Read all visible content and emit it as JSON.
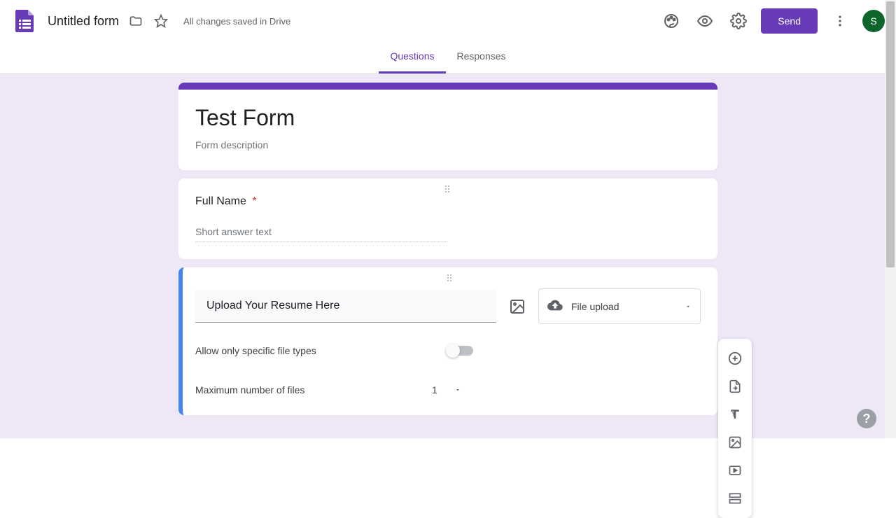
{
  "header": {
    "form_name": "Untitled form",
    "save_status": "All changes saved in Drive",
    "send_label": "Send",
    "avatar_initial": "S"
  },
  "tabs": {
    "questions": "Questions",
    "responses": "Responses"
  },
  "form": {
    "title": "Test Form",
    "description_placeholder": "Form description"
  },
  "q1": {
    "label": "Full Name",
    "required_mark": "*",
    "answer_placeholder": "Short answer text"
  },
  "q2": {
    "question_text": "Upload Your Resume Here",
    "type_label": "File upload",
    "allow_specific_label": "Allow only specific file types",
    "max_files_label": "Maximum number of files",
    "max_files_value": "1"
  },
  "icons": {
    "drag_dots": "⠿"
  }
}
